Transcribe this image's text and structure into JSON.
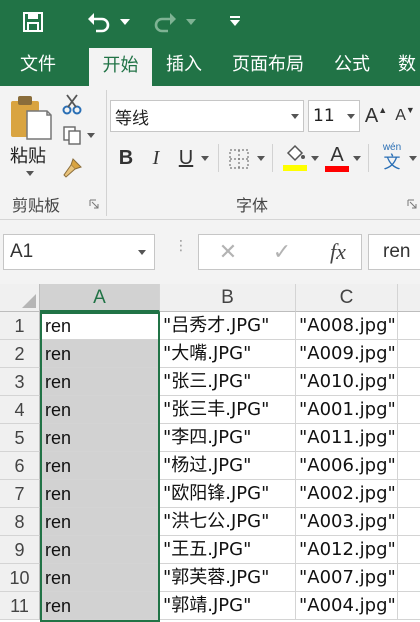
{
  "qat": {
    "icons": [
      "save-icon",
      "undo-icon",
      "redo-icon",
      "customize-icon"
    ],
    "colors": {
      "bar": "#217346",
      "text": "#ffffff"
    }
  },
  "tabs": [
    "文件",
    "开始",
    "插入",
    "页面布局",
    "公式",
    "数"
  ],
  "active_tab": "开始",
  "ribbon": {
    "clipboard": {
      "paste_label": "粘贴",
      "group_label": "剪贴板"
    },
    "font": {
      "font_name": "等线",
      "font_size": "11",
      "grow_label": "A",
      "shrink_label": "A",
      "bold_label": "B",
      "italic_label": "I",
      "underline_label": "U",
      "font_color_label": "A",
      "phonetic_top": "wén",
      "phonetic_bottom": "文",
      "group_label": "字体",
      "highlight_color": "#ffff00",
      "font_color": "#ff0000"
    }
  },
  "formula_bar": {
    "name_box": "A1",
    "cancel": "✕",
    "enter": "✓",
    "fx": "fx",
    "value": "ren"
  },
  "grid": {
    "columns": [
      "A",
      "B",
      "C"
    ],
    "selected_column": "A",
    "rows": [
      {
        "n": "1",
        "a": "ren",
        "b": "\"吕秀才.JPG\"",
        "c": "\"A008.jpg\""
      },
      {
        "n": "2",
        "a": "ren",
        "b": "\"大嘴.JPG\"",
        "c": "\"A009.jpg\""
      },
      {
        "n": "3",
        "a": "ren",
        "b": "\"张三.JPG\"",
        "c": "\"A010.jpg\""
      },
      {
        "n": "4",
        "a": "ren",
        "b": "\"张三丰.JPG\"",
        "c": "\"A001.jpg\""
      },
      {
        "n": "5",
        "a": "ren",
        "b": "\"李四.JPG\"",
        "c": "\"A011.jpg\""
      },
      {
        "n": "6",
        "a": "ren",
        "b": "\"杨过.JPG\"",
        "c": "\"A006.jpg\""
      },
      {
        "n": "7",
        "a": "ren",
        "b": "\"欧阳锋.JPG\"",
        "c": "\"A002.jpg\""
      },
      {
        "n": "8",
        "a": "ren",
        "b": "\"洪七公.JPG\"",
        "c": "\"A003.jpg\""
      },
      {
        "n": "9",
        "a": "ren",
        "b": "\"王五.JPG\"",
        "c": "\"A012.jpg\""
      },
      {
        "n": "10",
        "a": "ren",
        "b": "\"郭芙蓉.JPG\"",
        "c": "\"A007.jpg\""
      },
      {
        "n": "11",
        "a": "ren",
        "b": "\"郭靖.JPG\"",
        "c": "\"A004.jpg\""
      }
    ]
  }
}
